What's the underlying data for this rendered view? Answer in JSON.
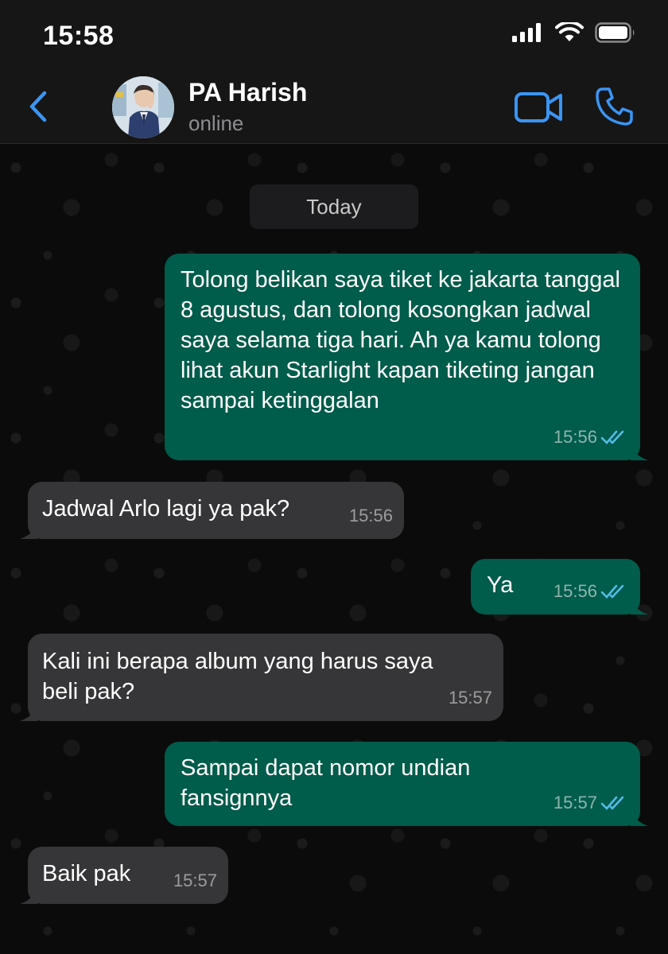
{
  "status_bar": {
    "time": "15:58",
    "icons": [
      "signal-icon",
      "wifi-icon",
      "battery-icon"
    ]
  },
  "header": {
    "back_icon": "chevron-left-icon",
    "contact_name": "PA Harish",
    "contact_status": "online",
    "video_icon": "video-camera-icon",
    "call_icon": "phone-icon"
  },
  "chat": {
    "date_chip": "Today",
    "messages": [
      {
        "direction": "out",
        "text": "Tolong belikan saya tiket ke jakarta tanggal 8 agustus, dan tolong kosongkan jadwal saya selama tiga hari. Ah ya kamu tolong lihat akun Starlight kapan tiketing jangan sampai ketinggalan",
        "time": "15:56",
        "read": true
      },
      {
        "direction": "in",
        "text": "Jadwal Arlo lagi ya pak?",
        "time": "15:56"
      },
      {
        "direction": "out",
        "text": "Ya",
        "time": "15:56",
        "read": true
      },
      {
        "direction": "in",
        "text": "Kali ini berapa album yang harus saya beli pak?",
        "time": "15:57"
      },
      {
        "direction": "out",
        "text": "Sampai dapat nomor undian fansignnya",
        "time": "15:57",
        "read": true
      },
      {
        "direction": "in",
        "text": "Baik pak",
        "time": "15:57"
      }
    ]
  },
  "colors": {
    "accent": "#3a95f5",
    "outgoing_bubble": "#005c4b",
    "incoming_bubble": "#363638",
    "read_ticks": "#53bdeb"
  }
}
